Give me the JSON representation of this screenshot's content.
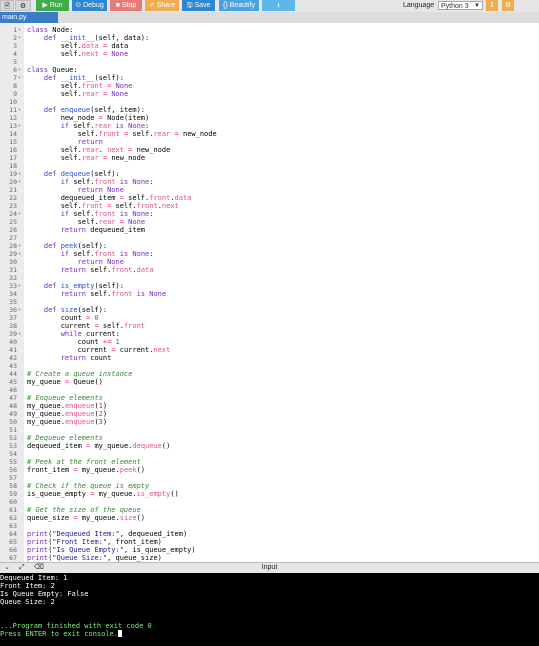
{
  "toolbar": {
    "run": "▶ Run",
    "debug": "⊙ Debug",
    "stop": "■ Stop",
    "share": "⇗ Share",
    "save": "🖫 Save",
    "beautify": "{} Beautify",
    "language_label": "Language",
    "language_value": "Python 3"
  },
  "tab": {
    "label": "main.py"
  },
  "editor": {
    "lines": [
      {
        "n": "1",
        "fold": true
      },
      {
        "n": "2",
        "fold": true
      },
      {
        "n": "3"
      },
      {
        "n": "4"
      },
      {
        "n": "5"
      },
      {
        "n": "6",
        "fold": true
      },
      {
        "n": "7",
        "fold": true
      },
      {
        "n": "8"
      },
      {
        "n": "9"
      },
      {
        "n": "10"
      },
      {
        "n": "11",
        "fold": true
      },
      {
        "n": "12"
      },
      {
        "n": "13",
        "fold": true
      },
      {
        "n": "14"
      },
      {
        "n": "15"
      },
      {
        "n": "16"
      },
      {
        "n": "17"
      },
      {
        "n": "18"
      },
      {
        "n": "19",
        "fold": true
      },
      {
        "n": "20",
        "fold": true
      },
      {
        "n": "21"
      },
      {
        "n": "22"
      },
      {
        "n": "23"
      },
      {
        "n": "24",
        "fold": true
      },
      {
        "n": "25"
      },
      {
        "n": "26"
      },
      {
        "n": "27"
      },
      {
        "n": "28",
        "fold": true
      },
      {
        "n": "29",
        "fold": true
      },
      {
        "n": "30"
      },
      {
        "n": "31"
      },
      {
        "n": "32"
      },
      {
        "n": "33",
        "fold": true
      },
      {
        "n": "34"
      },
      {
        "n": "35"
      },
      {
        "n": "36",
        "fold": true
      },
      {
        "n": "37"
      },
      {
        "n": "38"
      },
      {
        "n": "39",
        "fold": true
      },
      {
        "n": "40"
      },
      {
        "n": "41"
      },
      {
        "n": "42"
      },
      {
        "n": "43"
      },
      {
        "n": "44"
      },
      {
        "n": "45"
      },
      {
        "n": "46"
      },
      {
        "n": "47"
      },
      {
        "n": "48"
      },
      {
        "n": "49"
      },
      {
        "n": "50"
      },
      {
        "n": "51"
      },
      {
        "n": "52"
      },
      {
        "n": "53"
      },
      {
        "n": "54"
      },
      {
        "n": "55"
      },
      {
        "n": "56"
      },
      {
        "n": "57"
      },
      {
        "n": "58"
      },
      {
        "n": "59"
      },
      {
        "n": "60"
      },
      {
        "n": "61"
      },
      {
        "n": "62"
      },
      {
        "n": "63"
      },
      {
        "n": "64"
      },
      {
        "n": "65"
      },
      {
        "n": "66"
      },
      {
        "n": "67"
      }
    ],
    "code": [
      [
        [
          "kw",
          "class "
        ],
        [
          "",
          "Node:"
        ]
      ],
      [
        [
          "",
          "    "
        ],
        [
          "kw",
          "def "
        ],
        [
          "fn",
          "__init__"
        ],
        [
          "",
          "(self, data):"
        ]
      ],
      [
        [
          "",
          "        self."
        ],
        [
          "prop",
          "data"
        ],
        [
          "op",
          " = "
        ],
        [
          "",
          "data"
        ]
      ],
      [
        [
          "",
          "        self."
        ],
        [
          "prop",
          "next"
        ],
        [
          "op",
          " = "
        ],
        [
          "bi",
          "None"
        ]
      ],
      [],
      [
        [
          "kw",
          "class "
        ],
        [
          "",
          "Queue:"
        ]
      ],
      [
        [
          "",
          "    "
        ],
        [
          "kw",
          "def "
        ],
        [
          "fn",
          "__init__"
        ],
        [
          "",
          "(self):"
        ]
      ],
      [
        [
          "",
          "        self."
        ],
        [
          "prop",
          "front"
        ],
        [
          "op",
          " = "
        ],
        [
          "bi",
          "None"
        ]
      ],
      [
        [
          "",
          "        self."
        ],
        [
          "prop",
          "rear"
        ],
        [
          "op",
          " = "
        ],
        [
          "bi",
          "None"
        ]
      ],
      [],
      [
        [
          "",
          "    "
        ],
        [
          "kw",
          "def "
        ],
        [
          "fn",
          "enqueue"
        ],
        [
          "",
          "(self, item):"
        ]
      ],
      [
        [
          "",
          "        new_node "
        ],
        [
          "op",
          "= "
        ],
        [
          "",
          "Node(item)"
        ]
      ],
      [
        [
          "",
          "        "
        ],
        [
          "kw",
          "if "
        ],
        [
          "",
          "self."
        ],
        [
          "prop",
          "rear"
        ],
        [
          "kw",
          " is "
        ],
        [
          "bi",
          "None"
        ],
        [
          "",
          ":"
        ]
      ],
      [
        [
          "",
          "            self."
        ],
        [
          "prop",
          "front"
        ],
        [
          "op",
          " = "
        ],
        [
          "",
          "self."
        ],
        [
          "prop",
          "rear"
        ],
        [
          "op",
          " = "
        ],
        [
          "",
          "new_node"
        ]
      ],
      [
        [
          "",
          "            "
        ],
        [
          "kw",
          "return"
        ]
      ],
      [
        [
          "",
          "        self."
        ],
        [
          "prop",
          "rear"
        ],
        [
          "",
          ". "
        ],
        [
          "prop",
          "next"
        ],
        [
          "op",
          " = "
        ],
        [
          "",
          "new_node"
        ]
      ],
      [
        [
          "",
          "        self."
        ],
        [
          "prop",
          "rear"
        ],
        [
          "op",
          " = "
        ],
        [
          "",
          "new_node"
        ]
      ],
      [],
      [
        [
          "",
          "    "
        ],
        [
          "kw",
          "def "
        ],
        [
          "fn",
          "dequeue"
        ],
        [
          "",
          "(self):"
        ]
      ],
      [
        [
          "",
          "        "
        ],
        [
          "kw",
          "if "
        ],
        [
          "",
          "self."
        ],
        [
          "prop",
          "front"
        ],
        [
          "kw",
          " is "
        ],
        [
          "bi",
          "None"
        ],
        [
          "",
          ":"
        ]
      ],
      [
        [
          "",
          "            "
        ],
        [
          "kw",
          "return "
        ],
        [
          "bi",
          "None"
        ]
      ],
      [
        [
          "",
          "        dequeued_item "
        ],
        [
          "op",
          "= "
        ],
        [
          "",
          "self."
        ],
        [
          "prop",
          "front"
        ],
        [
          "",
          "."
        ],
        [
          "prop",
          "data"
        ]
      ],
      [
        [
          "",
          "        self."
        ],
        [
          "prop",
          "front"
        ],
        [
          "op",
          " = "
        ],
        [
          "",
          "self."
        ],
        [
          "prop",
          "front"
        ],
        [
          "",
          "."
        ],
        [
          "prop",
          "next"
        ]
      ],
      [
        [
          "",
          "        "
        ],
        [
          "kw",
          "if "
        ],
        [
          "",
          "self."
        ],
        [
          "prop",
          "front"
        ],
        [
          "kw",
          " is "
        ],
        [
          "bi",
          "None"
        ],
        [
          "",
          ":"
        ]
      ],
      [
        [
          "",
          "            self."
        ],
        [
          "prop",
          "rear"
        ],
        [
          "op",
          " = "
        ],
        [
          "bi",
          "None"
        ]
      ],
      [
        [
          "",
          "        "
        ],
        [
          "kw",
          "return "
        ],
        [
          "",
          "dequeued_item"
        ]
      ],
      [],
      [
        [
          "",
          "    "
        ],
        [
          "kw",
          "def "
        ],
        [
          "fn",
          "peek"
        ],
        [
          "",
          "(self):"
        ]
      ],
      [
        [
          "",
          "        "
        ],
        [
          "kw",
          "if "
        ],
        [
          "",
          "self."
        ],
        [
          "prop",
          "front"
        ],
        [
          "kw",
          " is "
        ],
        [
          "bi",
          "None"
        ],
        [
          "",
          ":"
        ]
      ],
      [
        [
          "",
          "            "
        ],
        [
          "kw",
          "return "
        ],
        [
          "bi",
          "None"
        ]
      ],
      [
        [
          "",
          "        "
        ],
        [
          "kw",
          "return "
        ],
        [
          "",
          "self."
        ],
        [
          "prop",
          "front"
        ],
        [
          "",
          "."
        ],
        [
          "prop",
          "data"
        ]
      ],
      [],
      [
        [
          "",
          "    "
        ],
        [
          "kw",
          "def "
        ],
        [
          "fn",
          "is_empty"
        ],
        [
          "",
          "(self):"
        ]
      ],
      [
        [
          "",
          "        "
        ],
        [
          "kw",
          "return "
        ],
        [
          "",
          "self."
        ],
        [
          "prop",
          "front"
        ],
        [
          "kw",
          " is "
        ],
        [
          "bi",
          "None"
        ]
      ],
      [],
      [
        [
          "",
          "    "
        ],
        [
          "kw",
          "def "
        ],
        [
          "fn",
          "size"
        ],
        [
          "",
          "(self):"
        ]
      ],
      [
        [
          "",
          "        count "
        ],
        [
          "op",
          "= "
        ],
        [
          "num",
          "0"
        ]
      ],
      [
        [
          "",
          "        current "
        ],
        [
          "op",
          "= "
        ],
        [
          "",
          "self."
        ],
        [
          "prop",
          "front"
        ]
      ],
      [
        [
          "",
          "        "
        ],
        [
          "kw",
          "while "
        ],
        [
          "",
          "current:"
        ]
      ],
      [
        [
          "",
          "            count "
        ],
        [
          "op",
          "+= "
        ],
        [
          "num",
          "1"
        ]
      ],
      [
        [
          "",
          "            current "
        ],
        [
          "op",
          "= "
        ],
        [
          "",
          "current."
        ],
        [
          "prop",
          "next"
        ]
      ],
      [
        [
          "",
          "        "
        ],
        [
          "kw",
          "return "
        ],
        [
          "",
          "count"
        ]
      ],
      [],
      [
        [
          "cm",
          "# Create a queue instance"
        ]
      ],
      [
        [
          "",
          "my_queue "
        ],
        [
          "op",
          "= "
        ],
        [
          "",
          "Queue()"
        ]
      ],
      [],
      [
        [
          "cm",
          "# Enqueue elements"
        ]
      ],
      [
        [
          "",
          "my_queue."
        ],
        [
          "prop",
          "enqueue"
        ],
        [
          "",
          "("
        ],
        [
          "num",
          "1"
        ],
        [
          "",
          ")"
        ]
      ],
      [
        [
          "",
          "my_queue."
        ],
        [
          "prop",
          "enqueue"
        ],
        [
          "",
          "("
        ],
        [
          "num",
          "2"
        ],
        [
          "",
          ")"
        ]
      ],
      [
        [
          "",
          "my_queue."
        ],
        [
          "prop",
          "enqueue"
        ],
        [
          "",
          "("
        ],
        [
          "num",
          "3"
        ],
        [
          "",
          ")"
        ]
      ],
      [],
      [
        [
          "cm",
          "# Dequeue elements"
        ]
      ],
      [
        [
          "",
          "dequeued_item "
        ],
        [
          "op",
          "= "
        ],
        [
          "",
          "my_queue."
        ],
        [
          "prop",
          "dequeue"
        ],
        [
          "",
          "()"
        ]
      ],
      [],
      [
        [
          "cm",
          "# Peek at the front element"
        ]
      ],
      [
        [
          "",
          "front_item "
        ],
        [
          "op",
          "= "
        ],
        [
          "",
          "my_queue."
        ],
        [
          "prop",
          "peek"
        ],
        [
          "",
          "()"
        ]
      ],
      [],
      [
        [
          "cm",
          "# Check if the queue is empty"
        ]
      ],
      [
        [
          "",
          "is_queue_empty "
        ],
        [
          "op",
          "= "
        ],
        [
          "",
          "my_queue."
        ],
        [
          "prop",
          "is_empty"
        ],
        [
          "",
          "()"
        ]
      ],
      [],
      [
        [
          "cm",
          "# Get the size of the queue"
        ]
      ],
      [
        [
          "",
          "queue_size "
        ],
        [
          "op",
          "= "
        ],
        [
          "",
          "my_queue."
        ],
        [
          "prop",
          "size"
        ],
        [
          "",
          "()"
        ]
      ],
      [],
      [
        [
          "kw",
          "print"
        ],
        [
          "",
          "("
        ],
        [
          "str",
          "\"Dequeued Item:\""
        ],
        [
          "",
          ", dequeued_item)"
        ]
      ],
      [
        [
          "kw",
          "print"
        ],
        [
          "",
          "("
        ],
        [
          "str",
          "\"Front Item:\""
        ],
        [
          "",
          ", front_item)"
        ]
      ],
      [
        [
          "kw",
          "print"
        ],
        [
          "",
          "("
        ],
        [
          "str",
          "\"Is Queue Empty:\""
        ],
        [
          "",
          ", is_queue_empty)"
        ]
      ],
      [
        [
          "kw",
          "print"
        ],
        [
          "",
          "("
        ],
        [
          "str",
          "\"Queue Size:\""
        ],
        [
          "",
          ", queue_size)"
        ]
      ]
    ]
  },
  "input_bar": {
    "title": "Input"
  },
  "console": {
    "lines": [
      {
        "text": "Dequeued Item: 1",
        "cls": ""
      },
      {
        "text": "Front Item: 2",
        "cls": ""
      },
      {
        "text": "Is Queue Empty: False",
        "cls": ""
      },
      {
        "text": "Queue Size: 2",
        "cls": ""
      },
      {
        "text": "",
        "cls": ""
      },
      {
        "text": "",
        "cls": ""
      },
      {
        "text": "...Program finished with exit code 0",
        "cls": "green"
      },
      {
        "text": "Press ENTER to exit console.",
        "cls": "green",
        "cursor": true
      }
    ]
  }
}
